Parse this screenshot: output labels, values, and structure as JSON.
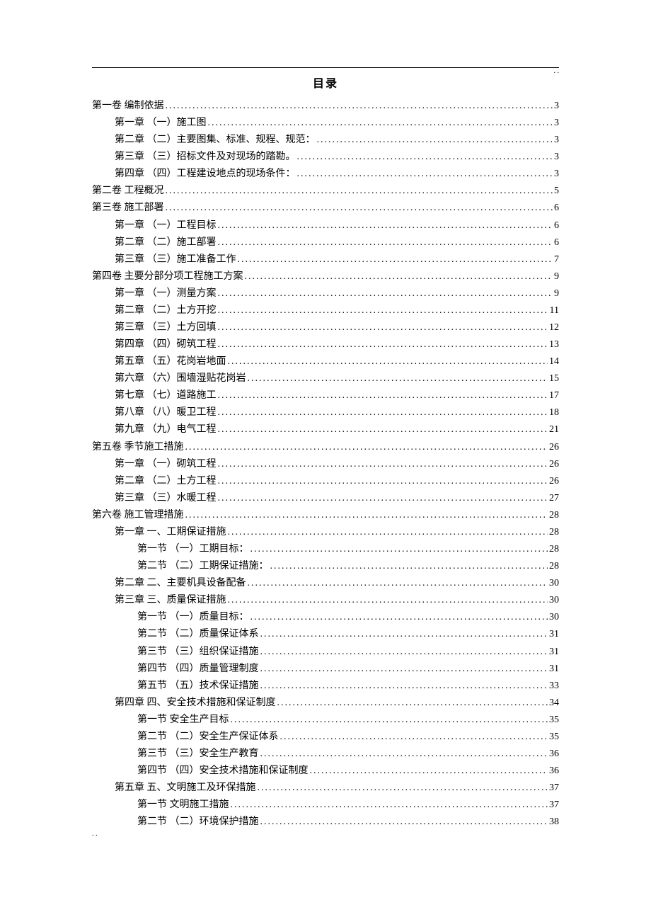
{
  "header_marker": ". .",
  "footer_marker": ". .",
  "title": "目录",
  "entries": [
    {
      "indent": 0,
      "label": "第一卷 编制依据",
      "page": "3"
    },
    {
      "indent": 1,
      "label": "第一章 （一）施工图 ",
      "page": "3"
    },
    {
      "indent": 1,
      "label": "第二章 （二）主要图集、标准、规程、规范：",
      "page": "3"
    },
    {
      "indent": 1,
      "label": "第三章 （三）招标文件及对现场的踏勘。",
      "page": "3"
    },
    {
      "indent": 1,
      "label": "第四章 （四）工程建设地点的现场条件：",
      "page": "3"
    },
    {
      "indent": 0,
      "label": "第二卷 工程概况",
      "page": "5"
    },
    {
      "indent": 0,
      "label": "第三卷 施工部署",
      "page": "6"
    },
    {
      "indent": 1,
      "label": "第一章 （一）工程目标 ",
      "page": "6"
    },
    {
      "indent": 1,
      "label": "第二章 （二）施工部署 ",
      "page": "6"
    },
    {
      "indent": 1,
      "label": "第三章 （三）施工准备工作 ",
      "page": "7"
    },
    {
      "indent": 0,
      "label": "第四卷 主要分部分项工程施工方案",
      "page": "9"
    },
    {
      "indent": 1,
      "label": "第一章 （一）测量方案 ",
      "page": "9"
    },
    {
      "indent": 1,
      "label": "第二章 （二）土方开挖 ",
      "page": "11"
    },
    {
      "indent": 1,
      "label": "第三章 （三）土方回填 ",
      "page": "12"
    },
    {
      "indent": 1,
      "label": "第四章 （四）砌筑工程 ",
      "page": "13"
    },
    {
      "indent": 1,
      "label": "第五章 （五）花岗岩地面 ",
      "page": "14"
    },
    {
      "indent": 1,
      "label": "第六章 （六）围墙湿贴花岗岩 ",
      "page": "15"
    },
    {
      "indent": 1,
      "label": "第七章 （七）道路施工 ",
      "page": "17"
    },
    {
      "indent": 1,
      "label": "第八章 （八）暖卫工程 ",
      "page": "18"
    },
    {
      "indent": 1,
      "label": "第九章 （九）电气工程 ",
      "page": "21"
    },
    {
      "indent": 0,
      "label": "第五卷 季节施工措施",
      "page": "26"
    },
    {
      "indent": 1,
      "label": "第一章 （一）砌筑工程 ",
      "page": "26"
    },
    {
      "indent": 1,
      "label": "第二章 （二）土方工程 ",
      "page": "26"
    },
    {
      "indent": 1,
      "label": "第三章 （三）水暖工程 ",
      "page": "27"
    },
    {
      "indent": 0,
      "label": "第六卷 施工管理措施",
      "page": "28"
    },
    {
      "indent": 1,
      "label": "第一章 一、工期保证措施 ",
      "page": "28"
    },
    {
      "indent": 2,
      "label": "第一节 （一）工期目标：",
      "page": "28"
    },
    {
      "indent": 2,
      "label": "第二节 （二）工期保证措施：",
      "page": "28"
    },
    {
      "indent": 1,
      "label": "第二章 二、主要机具设备配备 ",
      "page": "30"
    },
    {
      "indent": 1,
      "label": "第三章 三、质量保证措施 ",
      "page": "30"
    },
    {
      "indent": 2,
      "label": "第一节 （一）质量目标：",
      "page": "30"
    },
    {
      "indent": 2,
      "label": "第二节 （二）质量保证体系",
      "page": "31"
    },
    {
      "indent": 2,
      "label": "第三节 （三）组织保证措施",
      "page": "31"
    },
    {
      "indent": 2,
      "label": "第四节 （四）质量管理制度",
      "page": "31"
    },
    {
      "indent": 2,
      "label": "第五节 （五）技术保证措施",
      "page": "33"
    },
    {
      "indent": 1,
      "label": "第四章 四、安全技术措施和保证制度 ",
      "page": "34"
    },
    {
      "indent": 2,
      "label": "第一节 安全生产目标",
      "page": "35"
    },
    {
      "indent": 2,
      "label": "第二节 （二）安全生产保证体系",
      "page": "35"
    },
    {
      "indent": 2,
      "label": "第三节 （三）安全生产教育",
      "page": "36"
    },
    {
      "indent": 2,
      "label": "第四节 （四）安全技术措施和保证制度",
      "page": "36"
    },
    {
      "indent": 1,
      "label": "第五章 五、文明施工及环保措施 ",
      "page": "37"
    },
    {
      "indent": 2,
      "label": "第一节 文明施工措施",
      "page": "37"
    },
    {
      "indent": 2,
      "label": "第二节 （二）环境保护措施",
      "page": "38"
    }
  ]
}
